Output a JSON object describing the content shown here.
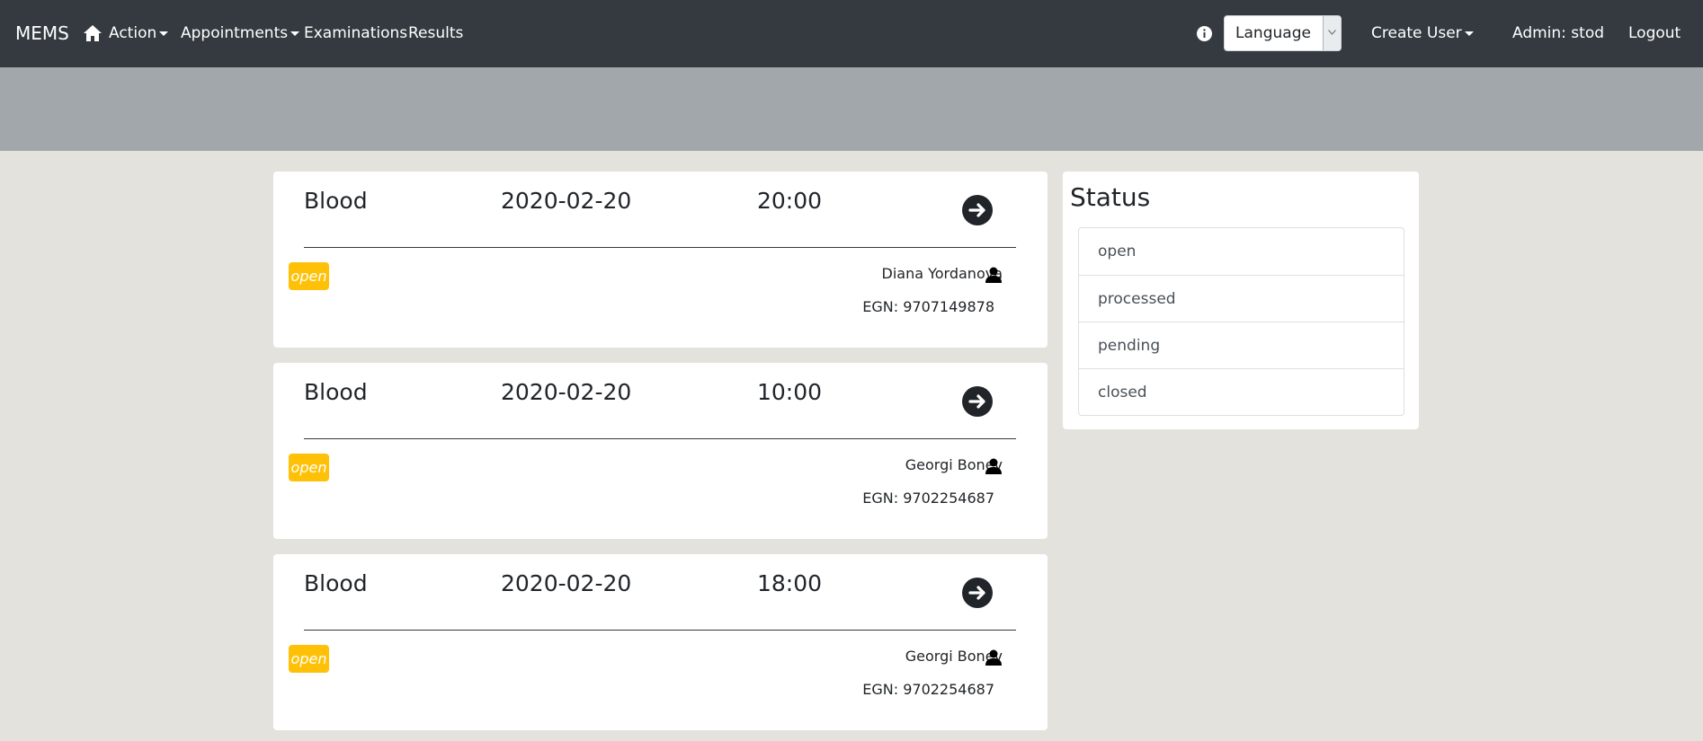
{
  "navbar": {
    "brand": "MEMS",
    "menu": {
      "action": "Action",
      "appointments": "Appointments",
      "examinations": "Examinations",
      "results": "Results"
    },
    "language_label": "Language",
    "create_user": "Create User",
    "admin_label": "Admin: stod",
    "logout": "Logout"
  },
  "appointments": [
    {
      "type": "Blood",
      "date": "2020-02-20",
      "time": "20:00",
      "status": "open",
      "patient": "Diana Yordanova",
      "egn": "EGN: 9707149878"
    },
    {
      "type": "Blood",
      "date": "2020-02-20",
      "time": "10:00",
      "status": "open",
      "patient": "Georgi Bonev",
      "egn": "EGN: 9702254687"
    },
    {
      "type": "Blood",
      "date": "2020-02-20",
      "time": "18:00",
      "status": "open",
      "patient": "Georgi Bonev",
      "egn": "EGN: 9702254687"
    }
  ],
  "status_panel": {
    "title": "Status",
    "items": [
      "open",
      "processed",
      "pending",
      "closed"
    ]
  },
  "colors": {
    "navbar_bg": "#343a40",
    "banner_bg": "#a2a7ab",
    "page_bg": "#e3e2dd",
    "badge_open": "#ffc107"
  },
  "icons": [
    "home-icon",
    "info-icon",
    "chevron-down-icon",
    "arrow-circle-right-icon",
    "user-icon"
  ]
}
